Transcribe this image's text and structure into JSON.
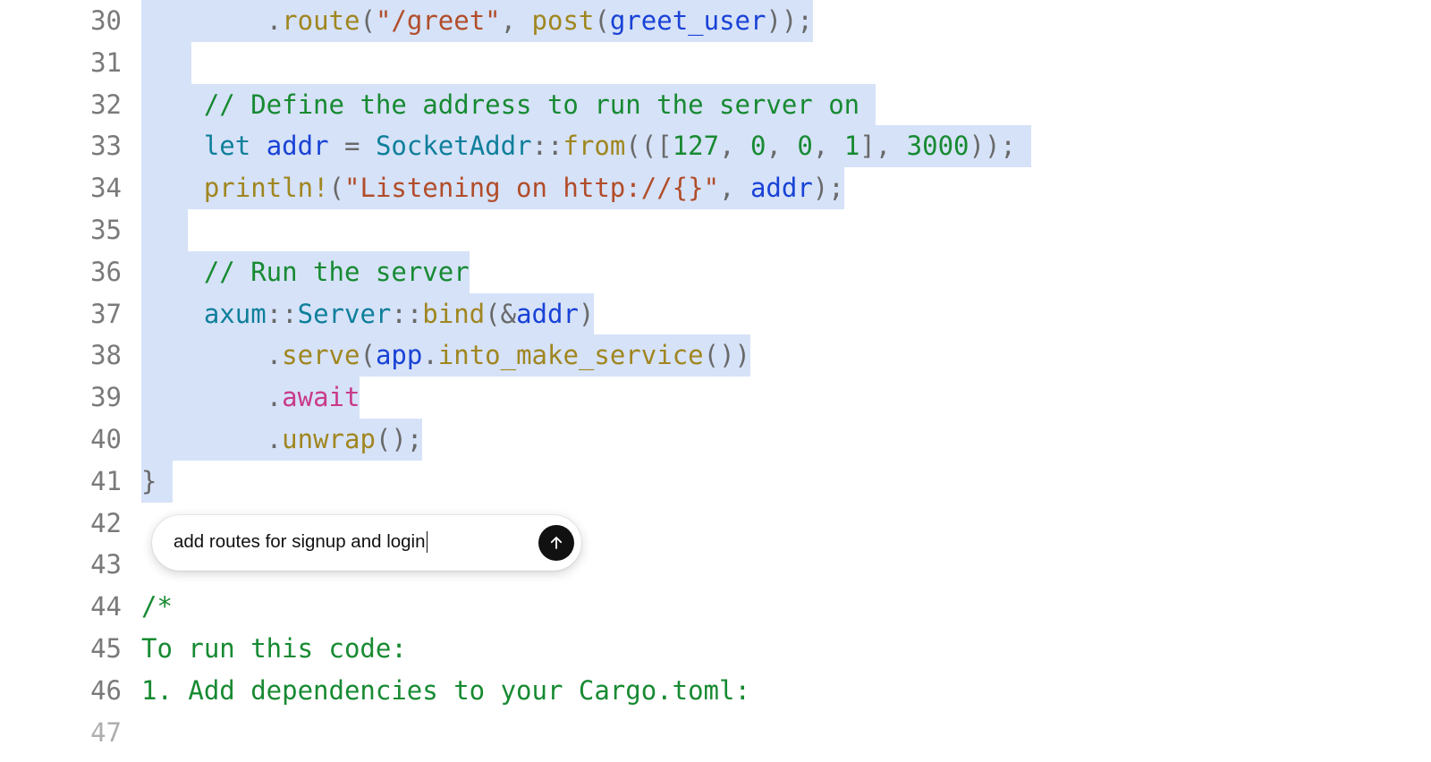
{
  "gutter": {
    "start": 30,
    "lines": [
      "30",
      "31",
      "32",
      "33",
      "34",
      "35",
      "36",
      "37",
      "38",
      "39",
      "40",
      "41",
      "42",
      "43",
      "44",
      "45",
      "46",
      "47"
    ]
  },
  "prompt": {
    "text": "add routes for signup and login"
  },
  "code": {
    "l30": {
      "indent": "        ",
      "dot": ".",
      "fn": "route",
      "open": "(",
      "str": "\"/greet\"",
      "comma": ", ",
      "post": "post",
      "open2": "(",
      "arg": "greet_user",
      "close": "));"
    },
    "l31": {
      "blank": ""
    },
    "l32": {
      "indent": "    ",
      "text": "// Define the address to run the server on"
    },
    "l33": {
      "indent": "    ",
      "let": "let",
      "sp1": " ",
      "name": "addr",
      "sp2": " ",
      "eq": "=",
      "sp3": " ",
      "type": "SocketAddr",
      "turb": "::",
      "from": "from",
      "open": "((",
      "obr": "[",
      "n1": "127",
      "c1": ", ",
      "n2": "0",
      "c2": ", ",
      "n3": "0",
      "c3": ", ",
      "n4": "1",
      "cbr": "]",
      "c4": ", ",
      "port": "3000",
      "close": "));"
    },
    "l34": {
      "indent": "    ",
      "macro": "println!",
      "open": "(",
      "str": "\"Listening on http://{}\"",
      "comma": ", ",
      "arg": "addr",
      "close": ");"
    },
    "l35": {
      "blank": ""
    },
    "l36": {
      "indent": "    ",
      "text": "// Run the server"
    },
    "l37": {
      "indent": "    ",
      "axum": "axum",
      "t1": "::",
      "server": "Server",
      "t2": "::",
      "bind": "bind",
      "open": "(",
      "amp": "&",
      "arg": "addr",
      "close": ")"
    },
    "l38": {
      "indent": "        ",
      "dot": ".",
      "serve": "serve",
      "open": "(",
      "app": "app",
      "dot2": ".",
      "ims": "into_make_service",
      "paren": "()",
      "close": ")"
    },
    "l39": {
      "indent": "        ",
      "dot": ".",
      "await": "await"
    },
    "l40": {
      "indent": "        ",
      "dot": ".",
      "unwrap": "unwrap",
      "paren": "();"
    },
    "l41": {
      "brace": "}"
    },
    "l42": {
      "blank": ""
    },
    "l43": {
      "blank": ""
    },
    "l44": {
      "text": "/*"
    },
    "l45": {
      "text": "To run this code:"
    },
    "l46": {
      "text": "1. Add dependencies to your Cargo.toml:"
    },
    "l47": {
      "blank": ""
    }
  }
}
